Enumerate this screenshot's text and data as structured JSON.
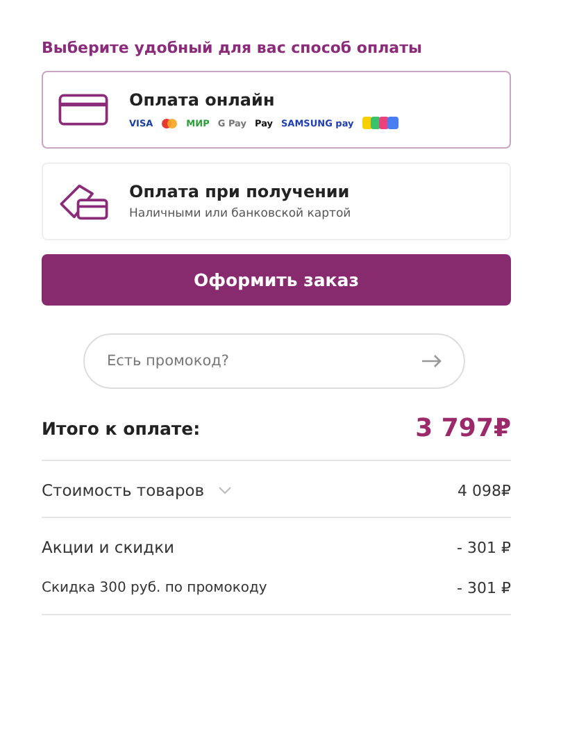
{
  "heading": "Выберите удобный для вас способ оплаты",
  "methods": [
    {
      "kind": "card",
      "title": "Оплата онлайн",
      "selected": true,
      "logos": [
        {
          "kind": "text",
          "label": "VISA",
          "color": "#1a3fa0"
        },
        {
          "kind": "dots"
        },
        {
          "kind": "text",
          "label": "МИР",
          "color": "#2e9e3a"
        },
        {
          "kind": "text",
          "label": "G Pay",
          "color": "#777777"
        },
        {
          "kind": "text",
          "label": "Pay",
          "color": "#111111"
        },
        {
          "kind": "text",
          "label": "SAMSUNG pay",
          "color": "#1f3fb0"
        },
        {
          "kind": "rainbow"
        }
      ]
    },
    {
      "kind": "cash",
      "title": "Оплата при получении",
      "subtitle": "Наличными или банковской картой",
      "selected": false
    }
  ],
  "submit": "Оформить заказ",
  "promo": {
    "placeholder": "Есть промокод?"
  },
  "total": {
    "label": "Итого к оплате:",
    "value": "3 797₽"
  },
  "lines": [
    {
      "label": "Стоимость товаров",
      "value": "4 098₽",
      "expandable": true,
      "small": false
    },
    {
      "label": "Акции и скидки",
      "value": "- 301 ₽",
      "expandable": false,
      "small": false
    },
    {
      "label": "Скидка 300 руб. по промокоду",
      "value": "- 301 ₽",
      "expandable": false,
      "small": true
    }
  ]
}
